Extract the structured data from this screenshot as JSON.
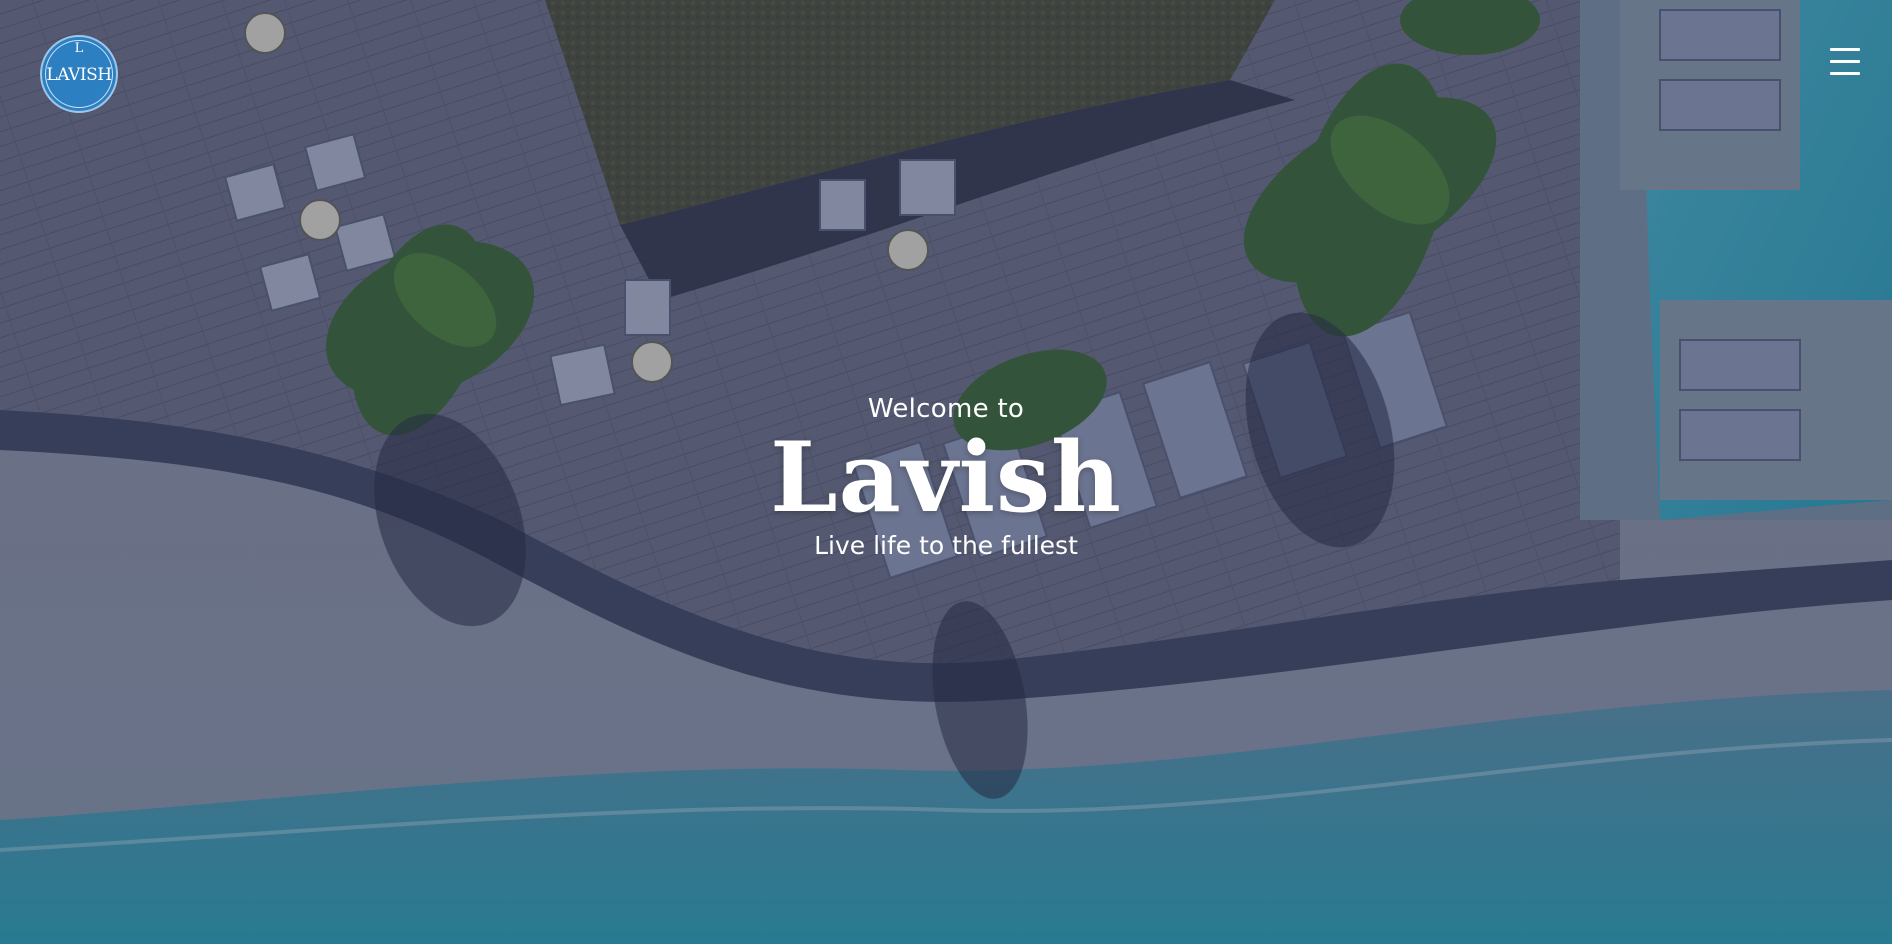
{
  "header": {
    "logo": {
      "letter": "L",
      "word": "LAVISH",
      "color": "#2c7fc0"
    },
    "menu_icon": "hamburger-menu-icon"
  },
  "hero": {
    "welcome": "Welcome to",
    "brand": "Lavish",
    "tagline": "Live life to the fullest",
    "background": "aerial-resort-deck-beach-image"
  },
  "colors": {
    "text": "#ffffff",
    "deck": "#6a6e80",
    "sand": "#9d9aa8",
    "water": "#3aa3b8"
  }
}
